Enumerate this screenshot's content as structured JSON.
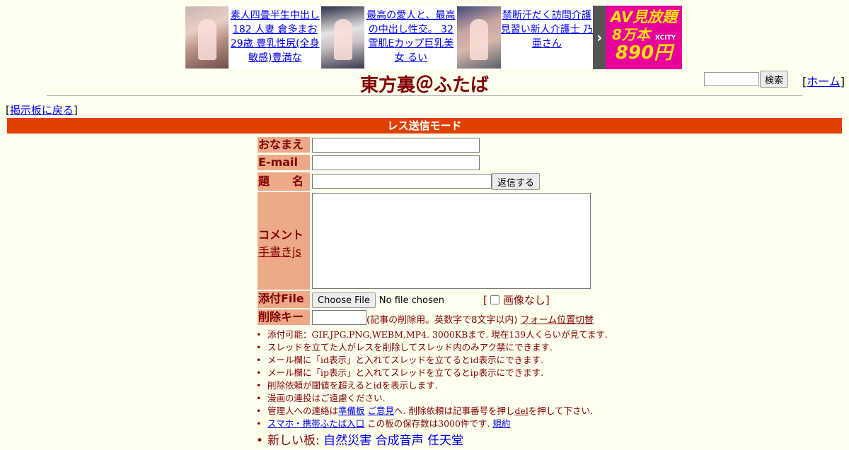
{
  "ad": {
    "items": [
      {
        "text": "素人四畳半生中出し182 人妻 倉多まお 29歳 豊乳性尻(全身敏感)豊満な"
      },
      {
        "text": "最高の愛人と、最高の中出し性交。 32 雪肌Eカップ巨乳美女 るい"
      },
      {
        "text": "禁断汗だく訪問介護 見習い新人介護士 乃亜さん"
      }
    ],
    "arrow": "›",
    "cta_line1": "AV見放題",
    "cta_line2": "8万本",
    "cta_brand": "XCITY",
    "cta_line3": "890円"
  },
  "header": {
    "title": "東方裏＠ふたば",
    "search_button": "検索",
    "home_bracket_open": "[",
    "home_link": "ホーム",
    "home_bracket_close": "]"
  },
  "nav": {
    "back_open": "[",
    "back_link": "掲示板に戻る",
    "back_close": "]"
  },
  "mode_bar": "レス送信モード",
  "form": {
    "name_label": "おなまえ",
    "email_label": "E-mail",
    "subject_label": "題　　名",
    "submit_button": "返信する",
    "comment_label": "コメント",
    "handwrite_link": "手書きjs",
    "file_label": "添付File",
    "file_button": "Choose File",
    "file_status": "No file chosen",
    "no_image_open": "[",
    "no_image_text": "画像なし]",
    "delkey_label": "削除キー",
    "delkey_note": "(記事の削除用。英数字で8文字以内)",
    "form_position_link": "フォーム位置切替"
  },
  "notes": {
    "n1": "添付可能：GIF,JPG,PNG,WEBM,MP4. 3000KBまで. 現在139人くらいが見てます.",
    "n2": "スレッドを立てた人がレスを削除してスレッド内のみアク禁にできます.",
    "n3": "メール欄に「id表示」と入れてスレッドを立てるとid表示にできます.",
    "n4": "メール欄に「ip表示」と入れてスレッドを立てるとip表示にできます.",
    "n5": "削除依頼が閾値を超えるとidを表示します.",
    "n6": "漫画の連投はご遠慮ください.",
    "n7_pre": "管理人への連絡は",
    "n7_link1": "準備板",
    "n7_link2": "ご意見",
    "n7_mid": "へ. 削除依頼は記事番号を押し",
    "n7_del": "del",
    "n7_post": "を押して下さい.",
    "n8_link": "スマホ・携帯ふたば入口",
    "n8_text": "この板の保存数は3000件です.",
    "n8_rules": "規約",
    "n9_label": "新しい板:",
    "n9_link1": "自然災害",
    "n9_link2": "合成音声",
    "n9_link3": "任天堂"
  }
}
